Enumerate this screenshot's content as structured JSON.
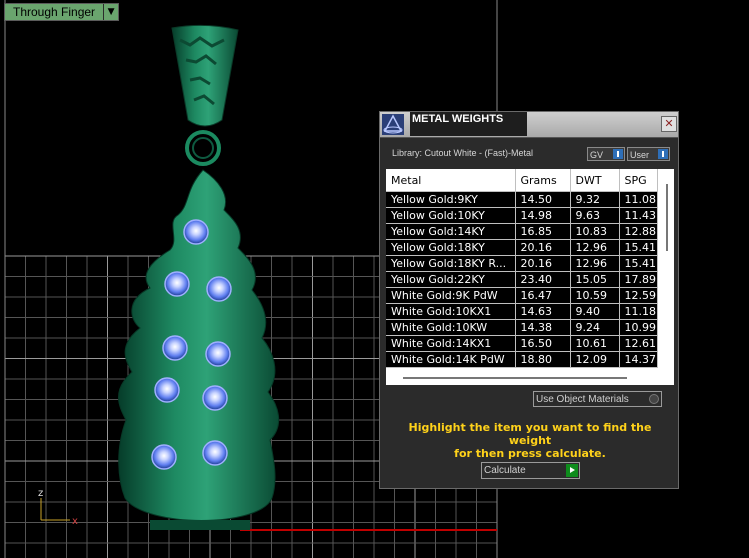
{
  "viewport": {
    "label": "Through Finger",
    "dropdown_icon": "chevron-down-icon",
    "axis_labels": {
      "z": "z",
      "x": "x"
    },
    "colors": {
      "pendant": "#0f6b4c",
      "gems": "#8aa2ff",
      "grid": "#7c7c7c",
      "background": "#000000"
    }
  },
  "panel": {
    "title": "METAL WEIGHTS",
    "close_label": "✕",
    "library_text": "Library: Cutout White - (Fast)-Metal",
    "gv_label": "GV",
    "user_label": "User",
    "columns": [
      "Metal",
      "Grams",
      "DWT",
      "SPG"
    ],
    "rows": [
      [
        "Yellow Gold:9KY",
        "14.50",
        "9.32",
        "11.08"
      ],
      [
        "Yellow Gold:10KY",
        "14.98",
        "9.63",
        "11.43"
      ],
      [
        "Yellow Gold:14KY",
        "16.85",
        "10.83",
        "12.88"
      ],
      [
        "Yellow Gold:18KY",
        "20.16",
        "12.96",
        "15.41"
      ],
      [
        "Yellow Gold:18KY R...",
        "20.16",
        "12.96",
        "15.41"
      ],
      [
        "Yellow Gold:22KY",
        "23.40",
        "15.05",
        "17.89"
      ],
      [
        "White Gold:9K PdW",
        "16.47",
        "10.59",
        "12.59"
      ],
      [
        "White Gold:10KX1",
        "14.63",
        "9.40",
        "11.18"
      ],
      [
        "White Gold:10KW",
        "14.38",
        "9.24",
        "10.99"
      ],
      [
        "White Gold:14KX1",
        "16.50",
        "10.61",
        "12.61"
      ],
      [
        "White Gold:14K PdW",
        "18.80",
        "12.09",
        "14.37"
      ]
    ],
    "use_object_label": "Use Object Materials",
    "hint_line1": "Highlight the item you want to find the weight",
    "hint_line2": "for then press calculate.",
    "calculate_label": "Calculate"
  }
}
